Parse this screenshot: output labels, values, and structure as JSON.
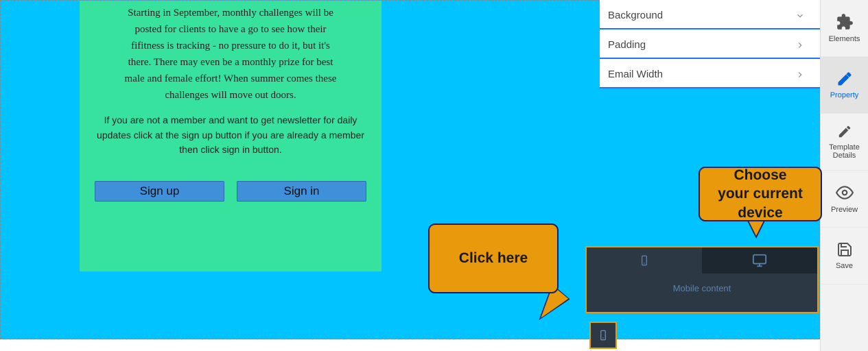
{
  "email": {
    "body": "Starting in September, monthly challenges will be posted for clients to have a go to see how their fifitness is tracking - no pressure to do it, but it's there. There may even be a monthly prize for best male and female effort! When summer comes these challenges will move out doors.",
    "cta": "If you are not a member and want to get newsletter for daily updates click at the sign up button if you are already a member then click sign in button.",
    "signup_label": "Sign up",
    "signin_label": "Sign in"
  },
  "props": {
    "rows": [
      "Background",
      "Padding",
      "Email Width"
    ]
  },
  "toolbar": {
    "elements": "Elements",
    "property": "Property",
    "template_details": "Template\nDetails",
    "preview": "Preview",
    "save": "Save"
  },
  "device_bar": {
    "label": "Mobile content"
  },
  "callouts": {
    "click_here": "Click here",
    "choose_device": "Choose your current device"
  },
  "colors": {
    "canvas": "#00c3ff",
    "card": "#36e29d",
    "button": "#3f8fd9",
    "callout_bg": "#e89a0c",
    "callout_border": "#1a2260",
    "accent": "#1976ff"
  }
}
